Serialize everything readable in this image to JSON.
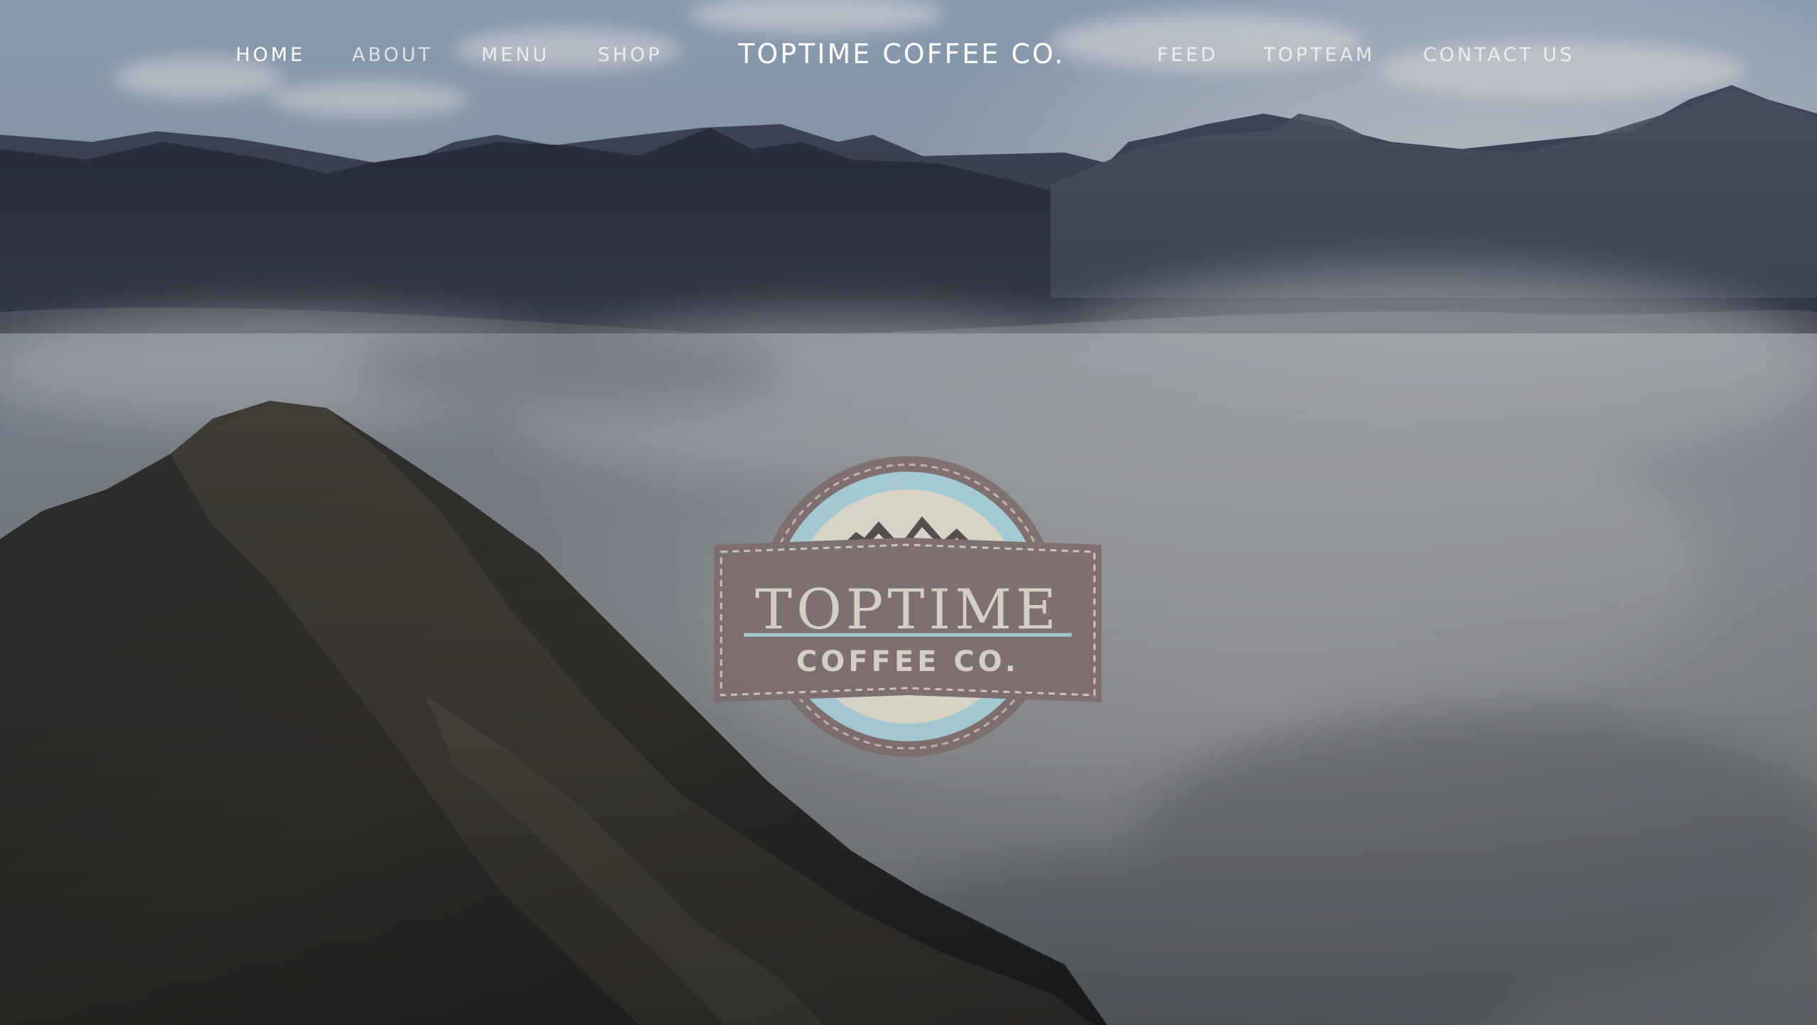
{
  "nav": {
    "left": [
      {
        "label": "HOME",
        "active": true
      },
      {
        "label": "ABOUT",
        "active": false
      },
      {
        "label": "MENU",
        "active": false
      },
      {
        "label": "SHOP",
        "active": false
      }
    ],
    "brand": "TOPTIME COFFEE CO.",
    "right": [
      {
        "label": "FEED",
        "active": false
      },
      {
        "label": "TOPTEAM",
        "active": false
      },
      {
        "label": "CONTACT US",
        "active": false
      }
    ]
  },
  "logo": {
    "line1": "TopTime",
    "line2": "COFFEE CO."
  },
  "colors": {
    "badge_brown": "#7d6a69",
    "badge_blue": "#a9d6df",
    "badge_cream": "#e8e2d2",
    "mountain_dark": "#2e3440",
    "mist": "#d8dbe0",
    "sky": "#b9c7d6"
  }
}
